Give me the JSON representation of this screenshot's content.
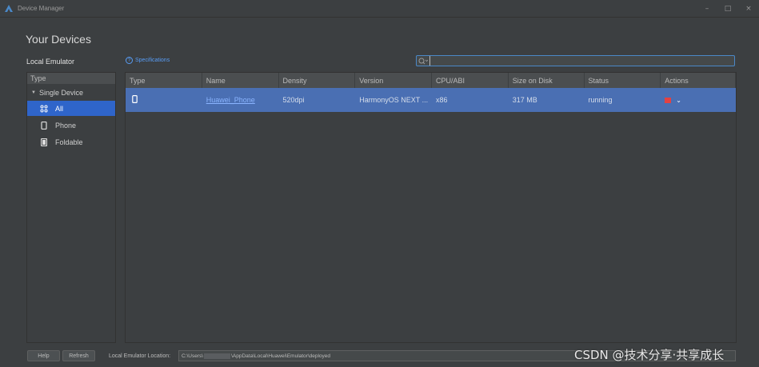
{
  "window": {
    "title": "Device Manager",
    "controls": {
      "minimize": "–",
      "maximize": "□",
      "close": "×"
    }
  },
  "page_title": "Your Devices",
  "left": {
    "header": "Local Emulator",
    "type_header": "Type",
    "group": "Single Device",
    "items": [
      {
        "label": "All",
        "icon": "grid-icon",
        "selected": true
      },
      {
        "label": "Phone",
        "icon": "phone-icon",
        "selected": false
      },
      {
        "label": "Foldable",
        "icon": "foldable-icon",
        "selected": false
      }
    ]
  },
  "specifications_link": "Specifications",
  "search": {
    "value": "",
    "placeholder": ""
  },
  "table": {
    "columns": [
      "Type",
      "Name",
      "Density",
      "Version",
      "CPU/ABI",
      "Size on Disk",
      "Status",
      "Actions"
    ],
    "rows": [
      {
        "type_icon": "phone-icon",
        "name": "Huawei_Phone",
        "density": "520dpi",
        "version": "HarmonyOS NEXT ...",
        "cpu_abi": "x86",
        "size_on_disk": "317 MB",
        "status": "running"
      }
    ]
  },
  "footer": {
    "help_label": "Help",
    "refresh_label": "Refresh",
    "location_label": "Local Emulator Location:",
    "location_prefix": "C:\\Users\\",
    "location_suffix": "\\AppData\\Local\\Huawei\\Emulator\\deployed"
  },
  "watermark": "CSDN @技术分享·共享成长",
  "colors": {
    "background": "#3c3f41",
    "selection": "#2f65ca",
    "row_selected": "#4a6fb3",
    "link": "#589df6",
    "stop": "#e34242"
  }
}
